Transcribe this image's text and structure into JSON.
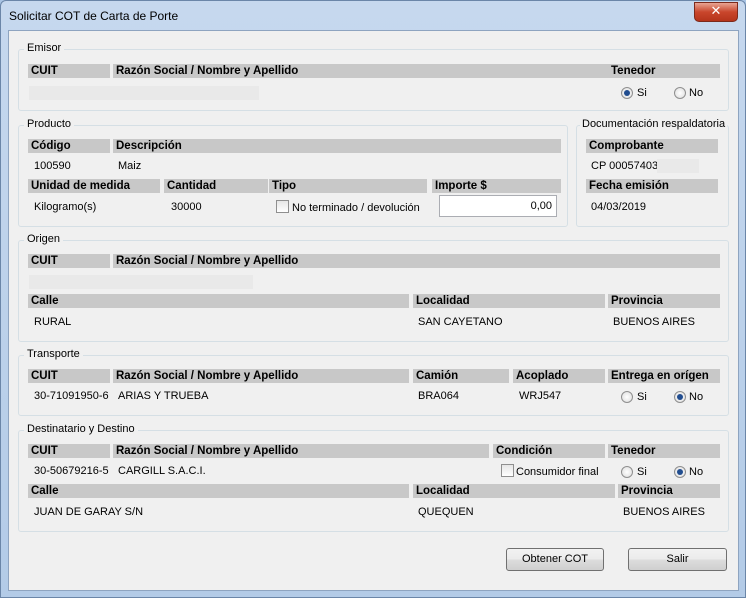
{
  "window": {
    "title": "Solicitar COT de Carta de Porte",
    "close_glyph": "✕"
  },
  "emisor": {
    "group_label": "Emisor",
    "headers": {
      "cuit": "CUIT",
      "razon": "Razón Social / Nombre y Apellido",
      "tenedor": "Tenedor"
    },
    "cuit_value": "",
    "razon_value": "",
    "tenedor_options": {
      "si": "Si",
      "no": "No",
      "selected": "Si"
    }
  },
  "producto": {
    "group_label": "Producto",
    "headers": {
      "codigo": "Código",
      "descripcion": "Descripción",
      "unidad": "Unidad de medida",
      "cantidad": "Cantidad",
      "tipo": "Tipo",
      "importe": "Importe $"
    },
    "codigo": "100590",
    "descripcion": "Maiz",
    "unidad": "Kilogramo(s)",
    "cantidad": "30000",
    "tipo_checkbox_label": "No terminado / devolución",
    "tipo_checked": false,
    "importe": "0,00"
  },
  "documentacion": {
    "group_label": "Documentación respaldatoria",
    "headers": {
      "comprobante": "Comprobante",
      "fecha": "Fecha emisión"
    },
    "comprobante": "CP 00057403",
    "fecha": "04/03/2019"
  },
  "origen": {
    "group_label": "Origen",
    "headers": {
      "cuit": "CUIT",
      "razon": "Razón Social / Nombre y Apellido",
      "calle": "Calle",
      "localidad": "Localidad",
      "provincia": "Provincia"
    },
    "cuit_value": "",
    "razon_value": "",
    "calle": "RURAL",
    "localidad": "SAN CAYETANO",
    "provincia": "BUENOS AIRES"
  },
  "transporte": {
    "group_label": "Transporte",
    "headers": {
      "cuit": "CUIT",
      "razon": "Razón Social / Nombre y Apellido",
      "camion": "Camión",
      "acoplado": "Acoplado",
      "entrega": "Entrega en orígen"
    },
    "cuit": "30-71091950-6",
    "razon": "ARIAS Y TRUEBA",
    "camion": "BRA064",
    "acoplado": "WRJ547",
    "entrega_options": {
      "si": "Si",
      "no": "No",
      "selected": "No"
    }
  },
  "destinatario": {
    "group_label": "Destinatario y Destino",
    "headers": {
      "cuit": "CUIT",
      "razon": "Razón Social / Nombre y Apellido",
      "condicion": "Condición",
      "tenedor": "Tenedor",
      "calle": "Calle",
      "localidad": "Localidad",
      "provincia": "Provincia"
    },
    "cuit": "30-50679216-5",
    "razon": "CARGILL S.A.C.I.",
    "condicion_checkbox_label": "Consumidor final",
    "condicion_checked": false,
    "tenedor_options": {
      "si": "Si",
      "no": "No",
      "selected": "No"
    },
    "calle": "JUAN DE GARAY S/N",
    "localidad": "QUEQUEN",
    "provincia": "BUENOS AIRES"
  },
  "buttons": {
    "obtener": "Obtener COT",
    "salir": "Salir"
  }
}
